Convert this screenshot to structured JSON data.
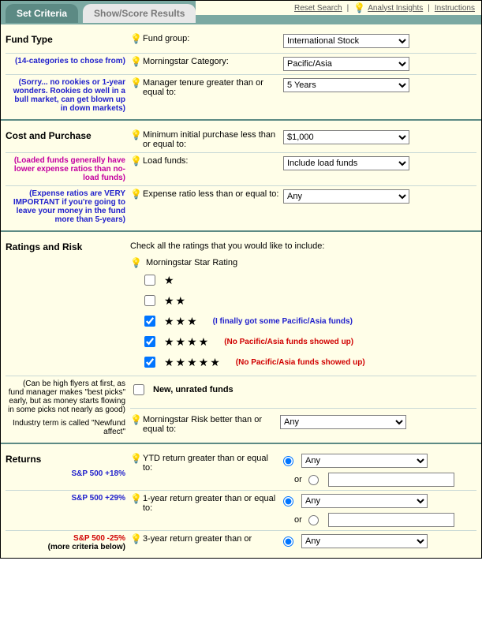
{
  "tabs": {
    "active": "Set Criteria",
    "inactive": "Show/Score Results"
  },
  "topnav": {
    "reset": "Reset Search",
    "analyst": "Analyst Insights",
    "instructions": "Instructions"
  },
  "fundType": {
    "heading": "Fund Type",
    "note1": "(14-categories to chose from)",
    "note2": "(Sorry... no rookies or 1-year wonders. Rookies do well in a bull market, can get blown up in down markets)",
    "group_label": "Fund group:",
    "group_value": "International Stock",
    "cat_label": "Morningstar Category:",
    "cat_value": "Pacific/Asia",
    "tenure_label": "Manager tenure greater than or equal to:",
    "tenure_value": "5 Years"
  },
  "cost": {
    "heading": "Cost and Purchase",
    "note1": "(Loaded funds generally have lower expense ratios than no-load funds)",
    "note2": "(Expense ratios are VERY IMPORTANT if you're going to leave your money in the fund more than 5-years)",
    "min_label": "Minimum initial purchase less than or equal to:",
    "min_value": "$1,000",
    "load_label": "Load funds:",
    "load_value": "Include load funds",
    "exp_label": "Expense ratio less than or equal to:",
    "exp_value": "Any"
  },
  "ratings": {
    "heading": "Ratings and Risk",
    "check_label": "Check all the ratings that you would like to include:",
    "star_label": "Morningstar Star Rating",
    "rows": [
      {
        "stars": "★",
        "checked": false,
        "note": "",
        "color": ""
      },
      {
        "stars": "★★",
        "checked": false,
        "note": "",
        "color": ""
      },
      {
        "stars": "★★★",
        "checked": true,
        "note": "(I finally got some Pacific/Asia funds)",
        "color": "blue"
      },
      {
        "stars": "★★★★",
        "checked": true,
        "note": "(No Pacific/Asia funds showed up)",
        "color": "red"
      },
      {
        "stars": "★★★★★",
        "checked": true,
        "note": "(No Pacific/Asia funds showed up)",
        "color": "red"
      }
    ],
    "new_label": "New, unrated funds",
    "new_checked": false,
    "new_note": "(Can be high flyers at first, as fund manager makes \"best picks\" early, but as money starts flowing in some picks not nearly as good)",
    "new_note2": "Industry term is called \"Newfund affect\"",
    "risk_label": "Morningstar Risk better than or equal to:",
    "risk_value": "Any"
  },
  "returns": {
    "heading": "Returns",
    "sp1": "S&P 500 +18%",
    "sp2": "S&P 500 +29%",
    "sp3": "S&P 500 -25%",
    "more": "(more criteria below)",
    "ytd_label": "YTD return greater than or equal to:",
    "ytd_value": "Any",
    "y1_label": "1-year return greater than or equal to:",
    "y1_value": "Any",
    "y3_label": "3-year return greater than or",
    "y3_value": "Any",
    "or": "or"
  }
}
